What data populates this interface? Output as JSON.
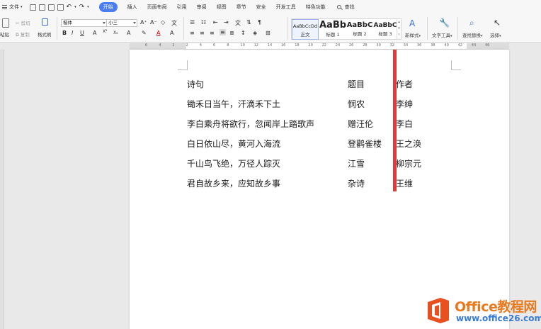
{
  "menubar": {
    "file_label": "文件",
    "tabs": [
      "开始",
      "插入",
      "页面布局",
      "引用",
      "审阅",
      "视图",
      "章节",
      "安全",
      "开发工具",
      "特色功能"
    ],
    "active_tab": "开始",
    "search_label": "查找",
    "accent_color": "#4c7cf3"
  },
  "ribbon": {
    "paste_label": "粘贴",
    "cut_label": "剪切",
    "copy_label": "复制",
    "format_painter_label": "格式刷",
    "font_name": "楷体",
    "font_size": "小三",
    "styles": [
      {
        "preview": "AaBbCcDd",
        "name": "正文"
      },
      {
        "preview": "AaBb",
        "name": "标题 1"
      },
      {
        "preview": "AaBbC",
        "name": "标题 2"
      },
      {
        "preview": "AaBbC",
        "name": "标题 3"
      }
    ],
    "new_style_label": "新样式",
    "text_tools_label": "文字工具",
    "find_replace_label": "查找替换",
    "select_label": "选择"
  },
  "ruler": {
    "ticks": [
      "6",
      "4",
      "2",
      "2",
      "4",
      "6",
      "8",
      "10",
      "12",
      "14",
      "16",
      "18",
      "20",
      "22",
      "24",
      "26",
      "28",
      "30",
      "32",
      "34",
      "36",
      "38",
      "40",
      "42",
      "44",
      "46"
    ]
  },
  "document": {
    "rows": [
      {
        "poem": "诗句",
        "title": "题目",
        "author": "作者"
      },
      {
        "poem": "锄禾日当午，汗滴禾下土",
        "title": "悯农",
        "author": "李绅"
      },
      {
        "poem": "李白乘舟将欲行，忽闻岸上踏歌声",
        "title": "赠汪伦",
        "author": "李白"
      },
      {
        "poem": "白日依山尽，黄河入海流",
        "title": "登鹳雀楼",
        "author": "王之涣"
      },
      {
        "poem": "千山鸟飞绝，万径人踪灭",
        "title": "江雪",
        "author": "柳宗元"
      },
      {
        "poem": "君自故乡来，应知故乡事",
        "title": "杂诗",
        "author": "王维"
      }
    ]
  },
  "watermark": {
    "brand": "Office教程网",
    "url": "www.office26.com",
    "brand_color": "#e87a1f",
    "url_color": "#3a7bd5"
  }
}
